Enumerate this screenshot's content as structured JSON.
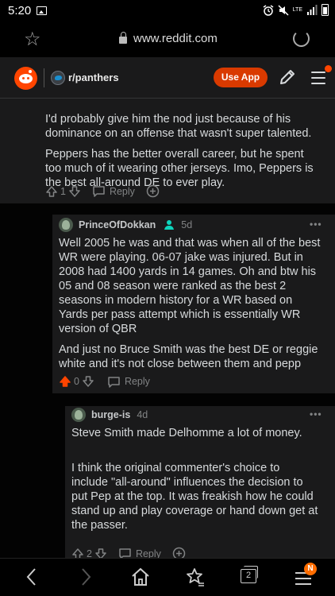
{
  "status_bar": {
    "time": "5:20",
    "network": "LTE"
  },
  "browser": {
    "url": "www.reddit.com"
  },
  "header": {
    "subreddit": "r/panthers",
    "use_app_label": "Use App"
  },
  "comments": [
    {
      "paragraphs": [
        "I'd probably give him the nod just because of his dominance on an offense that wasn't super talented.",
        "Peppers has the better overall career, but he spent too much of it wearing other jerseys. Imo, Peppers is the best all-around DE to ever play."
      ],
      "score": "1",
      "reply_label": "Reply"
    },
    {
      "author": "PrinceOfDokkan",
      "age": "5d",
      "paragraphs": [
        "Well 2005 he was and that was when all of the best WR were playing. 06-07 jake was injured. But in 2008 had 1400 yards in 14 games. Oh and btw his 05 and 08 season were ranked as the best 2 seasons in modern history for a WR based on Yards per pass attempt which is essentially WR version of QBR",
        "And just no Bruce Smith was the best DE or reggie white and it's not close between them and pepp"
      ],
      "score": "0",
      "reply_label": "Reply"
    },
    {
      "author": "burge-is",
      "age": "4d",
      "paragraphs": [
        "Steve Smith made Delhomme a lot of money.",
        "I think the original commenter's choice to include \"all-around\" influences the decision to put Pep at the top. It was freakish how he could stand up and play coverage or hand down get at the passer."
      ],
      "score": "2",
      "reply_label": "Reply"
    }
  ],
  "bottom_nav": {
    "tab_count": "2",
    "notification_badge": "N"
  },
  "colors": {
    "accent": "#ff4500",
    "use_app": "#d93a00",
    "upvoted": "#ff4500",
    "background": "#1a1a1b"
  }
}
